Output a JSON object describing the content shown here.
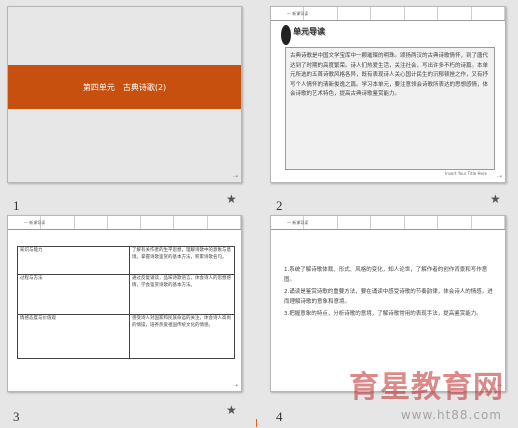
{
  "slides": [
    {
      "number": "1",
      "title": "第四单元　古典诗歌(2)"
    },
    {
      "number": "2",
      "header": "一 新课导读",
      "badge": "单元导读",
      "body": "古典诗歌是中国文学宝库中一颗璀璨的明珠。颂扬两汉的古典诗歌情怀，到了唐代达到了时期的高度繁荣。诗人们热爱生活，关注社会，写出许多不朽的诗篇。本单元所选的五首诗歌风格各异，既有表现诗人关心国计民生的沉郁顿挫之作，又有抒写个人情怀的清新俊逸之篇。学习本单元，要注意领会诗歌所表达的思想感情，体会诗歌的艺术特色，提高古典诗歌鉴赏能力。",
      "footer": "Insert Your Title Here"
    },
    {
      "number": "3",
      "header": "一 新课导读",
      "table": [
        {
          "label": "知识与能力",
          "text": "了解有关作者的生平思想，理解诗歌中的意象与意境，掌握诗歌鉴赏的基本方法，积累诗歌名句。"
        },
        {
          "label": "过程与方法",
          "text": "通过反复诵读，品味诗歌语言，体会诗人的思想感情，学会鉴赏诗歌的基本方法。"
        },
        {
          "label": "情感态度与价值观",
          "text": "感受诗人对国家和民族命运的关注，体会诗人高尚的情操，培养热爱祖国传统文化的情感。"
        }
      ]
    },
    {
      "number": "4",
      "header": "一 新课导读",
      "points": [
        "1.系统了解诗歌体裁、形式、风格的变化，知人论世，了解作者的创作背景和写作意图。",
        "2.诵读是鉴赏诗歌的重要方法，要在诵读中感受诗歌的节奏韵律，体会诗人的情感，进而理解诗歌的意象和意境。",
        "3.把握意象的特点，分析诗歌的意境，了解诗歌常用的表现手法，提高鉴赏能力。"
      ]
    }
  ],
  "watermark": {
    "main": "育星教育网",
    "url": "www.ht88.com"
  },
  "colors": {
    "accent": "#c8500e",
    "pane": "#e6e6e6"
  }
}
